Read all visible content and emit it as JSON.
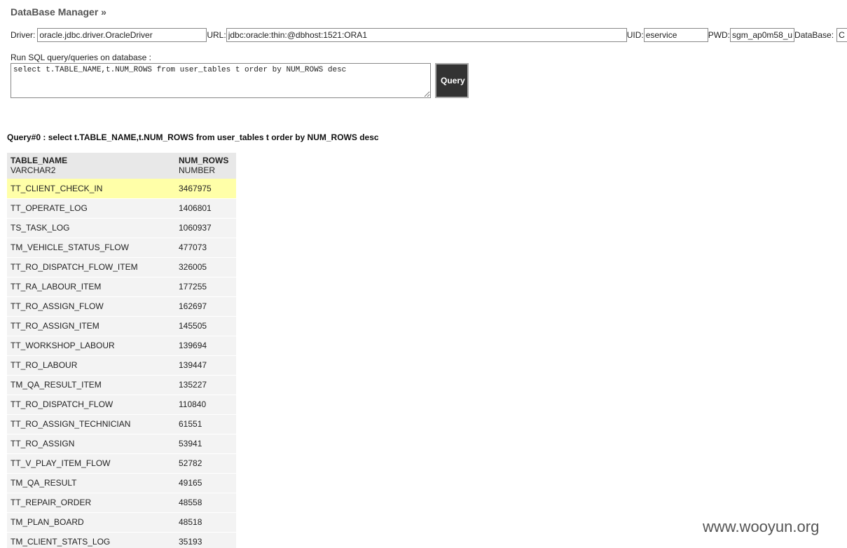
{
  "header": {
    "title": "DataBase Manager »"
  },
  "connection": {
    "driver_label": "Driver:",
    "driver_value": "oracle.jdbc.driver.OracleDriver",
    "url_label": "URL:",
    "url_value": "jdbc:oracle:thin:@dbhost:1521:ORA1",
    "uid_label": "UID:",
    "uid_value": "eservice",
    "pwd_label": "PWD:",
    "pwd_value": "sgm_ap0m58_u",
    "db_label": "DataBase:",
    "db_value": "C"
  },
  "sql": {
    "label": "Run SQL query/queries on database :",
    "text": "select t.TABLE_NAME,t.NUM_ROWS from user_tables t order by NUM_ROWS desc",
    "button_label": "Query"
  },
  "result": {
    "heading": "Query#0 : select t.TABLE_NAME,t.NUM_ROWS from user_tables t order by NUM_ROWS desc",
    "columns": [
      {
        "name": "TABLE_NAME",
        "type": "VARCHAR2"
      },
      {
        "name": "NUM_ROWS",
        "type": "NUMBER"
      }
    ],
    "rows": [
      [
        "TT_CLIENT_CHECK_IN",
        "3467975"
      ],
      [
        "TT_OPERATE_LOG",
        "1406801"
      ],
      [
        "TS_TASK_LOG",
        "1060937"
      ],
      [
        "TM_VEHICLE_STATUS_FLOW",
        "477073"
      ],
      [
        "TT_RO_DISPATCH_FLOW_ITEM",
        "326005"
      ],
      [
        "TT_RA_LABOUR_ITEM",
        "177255"
      ],
      [
        "TT_RO_ASSIGN_FLOW",
        "162697"
      ],
      [
        "TT_RO_ASSIGN_ITEM",
        "145505"
      ],
      [
        "TT_WORKSHOP_LABOUR",
        "139694"
      ],
      [
        "TT_RO_LABOUR",
        "139447"
      ],
      [
        "TM_QA_RESULT_ITEM",
        "135227"
      ],
      [
        "TT_RO_DISPATCH_FLOW",
        "110840"
      ],
      [
        "TT_RO_ASSIGN_TECHNICIAN",
        "61551"
      ],
      [
        "TT_RO_ASSIGN",
        "53941"
      ],
      [
        "TT_V_PLAY_ITEM_FLOW",
        "52782"
      ],
      [
        "TM_QA_RESULT",
        "49165"
      ],
      [
        "TT_REPAIR_ORDER",
        "48558"
      ],
      [
        "TM_PLAN_BOARD",
        "48518"
      ],
      [
        "TM_CLIENT_STATS_LOG",
        "35193"
      ]
    ],
    "highlighted_row": 0
  },
  "watermark": "www.wooyun.org"
}
